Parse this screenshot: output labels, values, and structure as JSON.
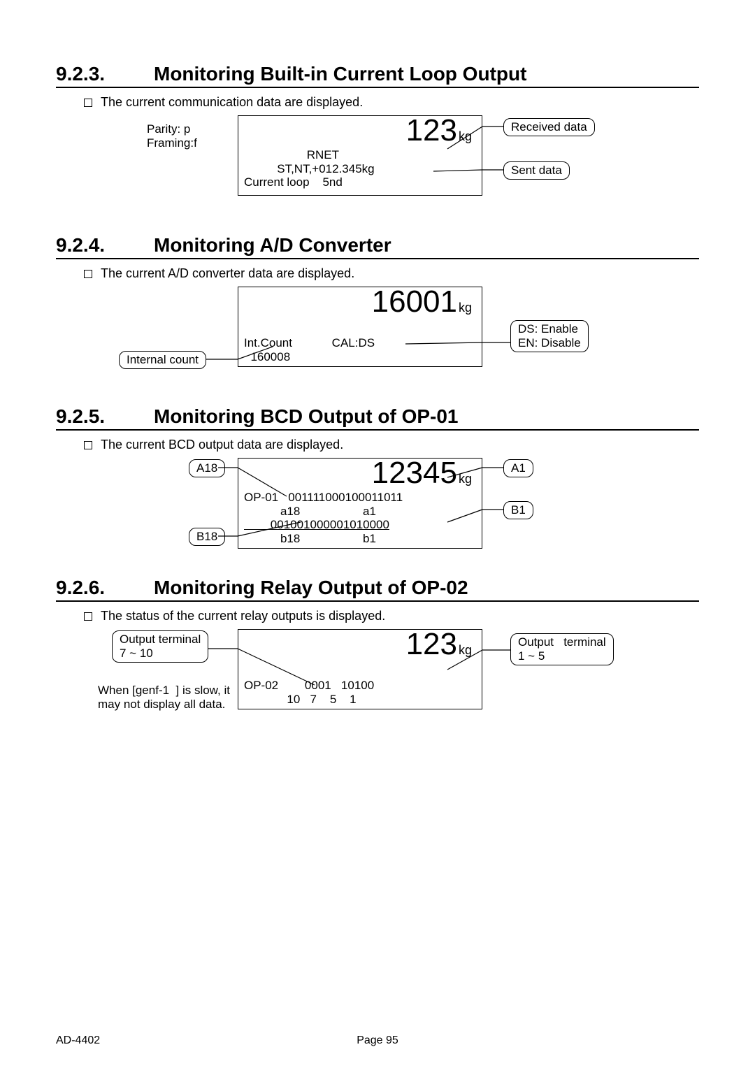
{
  "sections": {
    "s923": {
      "num": "9.2.3.",
      "title": "Monitoring Built-in Current Loop Output",
      "bullet": "The current communication data are displayed."
    },
    "s924": {
      "num": "9.2.4.",
      "title": "Monitoring A/D Converter",
      "bullet": "The current A/D converter data are displayed."
    },
    "s925": {
      "num": "9.2.5.",
      "title": "Monitoring BCD Output of OP-01",
      "bullet": "The current BCD output data are displayed."
    },
    "s926": {
      "num": "9.2.6.",
      "title": "Monitoring Relay Output of OP-02",
      "bullet": "The status of the current relay outputs is displayed."
    }
  },
  "d923": {
    "parity_note": "Parity: p\nFraming:f",
    "reading": "123",
    "unit": "kg",
    "line1": "                   RNET",
    "line2": "          ST,NT,+012.345kg",
    "line3": "Current loop    5nd",
    "callout_rx": "Received data",
    "callout_tx": "Sent data"
  },
  "d924": {
    "reading": "16001",
    "unit": "kg",
    "line1": "Int.Count            CAL:DS",
    "line2": "  160008",
    "callout_left": "Internal count",
    "callout_right": "DS: Enable\nEN: Disable"
  },
  "d925": {
    "reading": "12345",
    "unit": "kg",
    "line1": "OP-01   001111000100011011",
    "line2": "           a18                   a1",
    "line3": "        001001000001010000",
    "line4": "           b18                   b1",
    "cA18": "A18",
    "cB18": "B18",
    "cA1": "A1",
    "cB1": "B1"
  },
  "d926": {
    "reading": "123",
    "unit": "kg",
    "line1": "OP-02        0001   10100",
    "line2": "             10   7    5    1",
    "callout_left": "Output terminal\n7 ~ 10",
    "callout_right": "Output   terminal\n1 ~ 5",
    "note": "When [genf-1  ] is slow, it\nmay not display all data."
  },
  "footer": {
    "left": "AD-4402",
    "mid": "Page 95"
  }
}
